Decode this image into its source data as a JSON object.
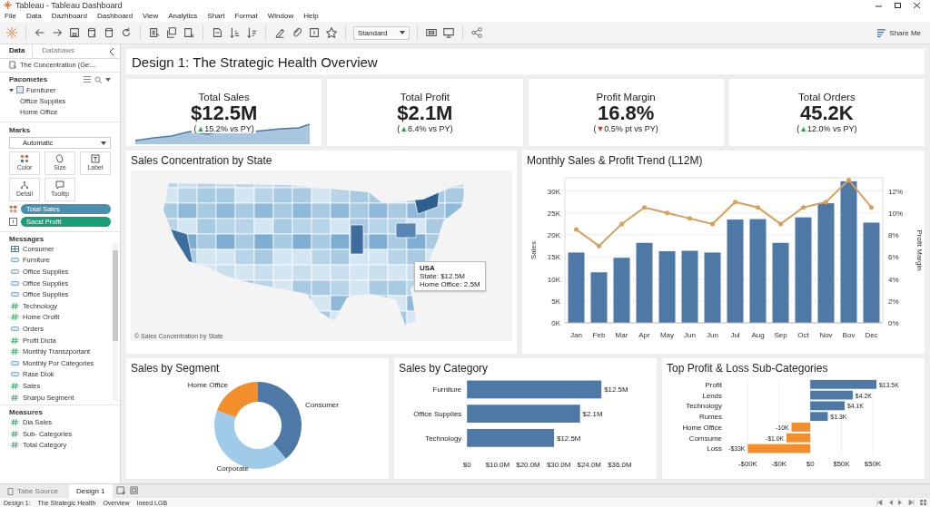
{
  "window": {
    "title": "Tableau - Tableau Dashboard"
  },
  "menu": [
    "File",
    "Data",
    "Dazhboard",
    "Dashboard",
    "View",
    "Analytics",
    "Shart",
    "Format",
    "Window",
    "Help"
  ],
  "toolbar": {
    "view_mode": "Standard",
    "share": "Share Me"
  },
  "sidebar": {
    "tabs": [
      {
        "label": "Data",
        "selected": true
      },
      {
        "label": "Databaws",
        "selected": false
      }
    ],
    "data_source": "The Concentration (Ge:...",
    "parameters": {
      "title": "Pacometes",
      "items": [
        {
          "label": "Furniturer",
          "expanded": true,
          "children": [
            {
              "label": "Office Supplies"
            },
            {
              "label": "Home Office"
            }
          ]
        }
      ]
    },
    "marks": {
      "title": "Marks",
      "type": "Automatic",
      "cards": [
        {
          "label": "Color",
          "kind": "color"
        },
        {
          "label": "Size",
          "kind": "size"
        },
        {
          "label": "Label",
          "kind": "label"
        },
        {
          "label": "Detail",
          "kind": "detail"
        },
        {
          "label": "Tooltip",
          "kind": "tooltip"
        }
      ],
      "pills": [
        {
          "label": "Total Sales",
          "kind": "color",
          "color": "#4a8fae"
        },
        {
          "label": "Sacst Profit",
          "kind": "label",
          "color": "#1b9e77"
        }
      ]
    },
    "dimensions": {
      "title": "Messages",
      "items": [
        {
          "label": "Consumer",
          "kind": "table"
        },
        {
          "label": "Furniture",
          "kind": "text"
        },
        {
          "label": "Office Supplies",
          "kind": "text"
        },
        {
          "label": "Office Supplies",
          "kind": "text"
        },
        {
          "label": "Office Supplies",
          "kind": "text"
        },
        {
          "label": "Technology",
          "kind": "number"
        },
        {
          "label": "Home Orofit",
          "kind": "number"
        },
        {
          "label": "Orders",
          "kind": "text"
        },
        {
          "label": "Profit Dicta",
          "kind": "number"
        },
        {
          "label": "Monthly Transzportant",
          "kind": "number"
        },
        {
          "label": "Monthly Por Categories",
          "kind": "text"
        },
        {
          "label": "Rase Diok",
          "kind": "text"
        },
        {
          "label": "Sates",
          "kind": "number"
        },
        {
          "label": "Sharpu Segment",
          "kind": "number"
        }
      ]
    },
    "measures": {
      "title": "Measures",
      "items": [
        {
          "label": "Dia Sales",
          "kind": "number"
        },
        {
          "label": "Sub- Categories",
          "kind": "number"
        },
        {
          "label": "Total Category",
          "kind": "number"
        }
      ]
    }
  },
  "dashboard": {
    "title": "Design 1: The Strategic Health Overview",
    "kpis": [
      {
        "label": "Total Sales",
        "value": "$12.5M",
        "sparkline": true,
        "delta": {
          "before": "(",
          "arrow": "▲",
          "after": "15.2% vs PY)",
          "color": "#2e9e4a"
        }
      },
      {
        "label": "Total Profit",
        "value": "$2.1M",
        "sparkline": false,
        "delta": {
          "before": "(",
          "arrow": "▲",
          "after": "8.4% vs PY)",
          "color": "#2e9e4a"
        }
      },
      {
        "label": "Profit Margin",
        "value": "16.8%",
        "sparkline": false,
        "delta": {
          "before": "(",
          "arrow": "▼",
          "after": "0.5% pt vs PY)",
          "color": "#d23a2a"
        }
      },
      {
        "label": "Total Orders",
        "value": "45.2K",
        "sparkline": false,
        "delta": {
          "before": "(",
          "arrow": "▲",
          "after": "12.0% vs PY)",
          "color": "#2e9e4a"
        }
      }
    ],
    "map": {
      "title": "Sales Concentration by State",
      "tooltip": {
        "title": "USA",
        "lines": [
          "State: $12.5M",
          "Home Office: 2.5M"
        ]
      },
      "caption": "© Sales Concentration by State"
    },
    "trend": {
      "title": "Monthly Sales & Profit Trend (L12M)",
      "sales": {
        "chart_data": {
          "type": "bar",
          "ylabel": "Sales",
          "grid": true,
          "categories": [
            "Jan",
            "Feb",
            "Mar",
            "Apr",
            "May",
            "Jun",
            "Jun",
            "Jul",
            "Aug",
            "Sep",
            "Oct",
            "Nov",
            "Bov",
            "Dec"
          ],
          "values": [
            16000,
            11500,
            14800,
            18200,
            16300,
            16400,
            16000,
            23500,
            23600,
            18200,
            24000,
            27200,
            32200,
            22800
          ],
          "ylim": [
            0,
            33000
          ],
          "yticks": [
            {
              "value": 0,
              "label": "0K"
            },
            {
              "value": 5000,
              "label": "5K"
            },
            {
              "value": 10000,
              "label": "10K"
            },
            {
              "value": 15000,
              "label": "15K"
            },
            {
              "value": 20000,
              "label": "20K"
            },
            {
              "value": 25000,
              "label": "25K"
            },
            {
              "value": 30000,
              "label": "30K"
            }
          ]
        }
      },
      "margin": {
        "chart_data": {
          "type": "line",
          "ylabel": "Profit Margin",
          "values": [
            8.5,
            7,
            9,
            10.5,
            10,
            9.5,
            9,
            11,
            10.5,
            9,
            10.5,
            11,
            13,
            10.5
          ],
          "ylim": [
            0,
            13.2
          ],
          "yticks": [
            {
              "value": 0,
              "label": "0%"
            },
            {
              "value": 2,
              "label": "2%"
            },
            {
              "value": 4,
              "label": "4%"
            },
            {
              "value": 6,
              "label": "6%"
            },
            {
              "value": 8,
              "label": "8%"
            },
            {
              "value": 10,
              "label": "10%"
            },
            {
              "value": 12,
              "label": "12%"
            }
          ]
        }
      }
    },
    "segment": {
      "title": "Sales by Segment",
      "segments": [
        {
          "label": "Consumer",
          "color": "#4e79a7"
        },
        {
          "label": "Corporate",
          "color": "#a0cbe8"
        },
        {
          "label": "Home Office",
          "color": "#f28e2b"
        }
      ]
    },
    "category": {
      "title": "Sales by Category",
      "rows": [
        {
          "label": "Furniture",
          "value_label": "$12.5M"
        },
        {
          "label": "Office Supplies",
          "value_label": "$2.1M"
        },
        {
          "label": "Technology",
          "value_label": "$12.5M"
        }
      ],
      "axis_labels": [
        "$0",
        "$10.0M",
        "$20.0M",
        "$30.0M",
        "$24.0M",
        "$36.0M"
      ]
    },
    "profit_loss": {
      "title": "Top Profit & Loss Sub-Categories",
      "rows": [
        {
          "label": "Profit",
          "value_label": "$13.5K",
          "kind": "gain"
        },
        {
          "label": "Lends",
          "value_label": "$4.2K",
          "kind": "gain"
        },
        {
          "label": "Technology",
          "value_label": "$4.1K",
          "kind": "gain"
        },
        {
          "label": "Rumes",
          "value_label": "$1.3K",
          "kind": "gain"
        },
        {
          "label": "Home Office",
          "value_label": "-10K",
          "kind": "loss"
        },
        {
          "label": "Cornsume",
          "value_label": "-$1.0K",
          "kind": "loss"
        },
        {
          "label": "Loss",
          "value_label": "-$33K",
          "kind": "loss"
        }
      ],
      "axis_labels": [
        "-$00K",
        "-$0K",
        "$0",
        "$50K",
        "$50K"
      ]
    }
  },
  "sheet_tabs": [
    {
      "label": "Tabe Source",
      "kind": "source",
      "selected": false
    },
    {
      "label": "Design 1",
      "kind": "sheet",
      "selected": true
    }
  ],
  "status_bar": [
    "Design 1:",
    "The Strategic Health",
    "Overview",
    "Ineed LGB"
  ]
}
